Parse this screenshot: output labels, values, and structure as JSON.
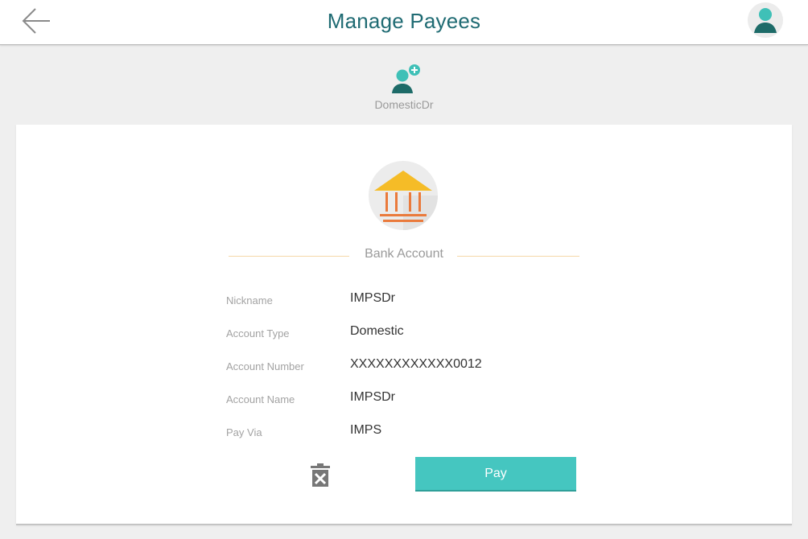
{
  "header": {
    "title": "Manage Payees",
    "back_icon": "arrow-left-icon",
    "profile_icon": "user-avatar-icon"
  },
  "payee": {
    "name": "DomesticDr",
    "icon": "add-user-icon"
  },
  "account_card": {
    "icon": "bank-icon",
    "section_label": "Bank Account",
    "details": [
      {
        "label": "Nickname",
        "value": "IMPSDr"
      },
      {
        "label": "Account Type",
        "value": "Domestic"
      },
      {
        "label": "Account Number",
        "value": "XXXXXXXXXXXX0012"
      },
      {
        "label": "Account Name",
        "value": "IMPSDr"
      },
      {
        "label": "Pay Via",
        "value": "IMPS"
      }
    ],
    "delete_icon": "trash-icon",
    "pay_label": "Pay"
  },
  "colors": {
    "accent": "#45c6c0",
    "title": "#1f6b73",
    "avatar_teal": "#3fc0b7",
    "avatar_dark": "#1d6b68",
    "bank_roof": "#f5bc27",
    "bank_columns": "#ea7a3c",
    "divider": "#f5d7a8"
  }
}
